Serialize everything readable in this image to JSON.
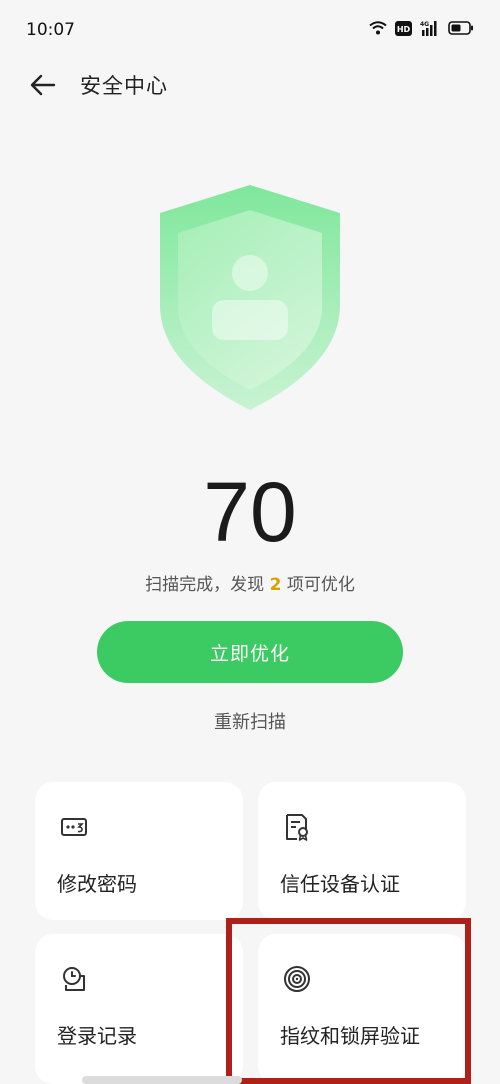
{
  "status_bar": {
    "time": "10:07",
    "icons": [
      "wifi-icon",
      "hd-icon",
      "4g-signal-icon",
      "battery-icon"
    ]
  },
  "header": {
    "title": "安全中心",
    "back_icon": "back-arrow-icon"
  },
  "score": {
    "value": "70"
  },
  "scan": {
    "prefix": "扫描完成，发现 ",
    "count": "2",
    "suffix": " 项可优化"
  },
  "actions": {
    "optimize_label": "立即优化",
    "rescan_label": "重新扫描"
  },
  "cards": [
    {
      "label": "修改密码",
      "icon": "password-icon"
    },
    {
      "label": "信任设备认证",
      "icon": "certificate-icon"
    },
    {
      "label": "登录记录",
      "icon": "login-record-icon"
    },
    {
      "label": "指纹和锁屏验证",
      "icon": "fingerprint-icon"
    }
  ],
  "colors": {
    "accent": "#3ccb63",
    "highlight_count": "#d8a200",
    "annotation": "#b0201a",
    "background": "#f6f6f6"
  }
}
